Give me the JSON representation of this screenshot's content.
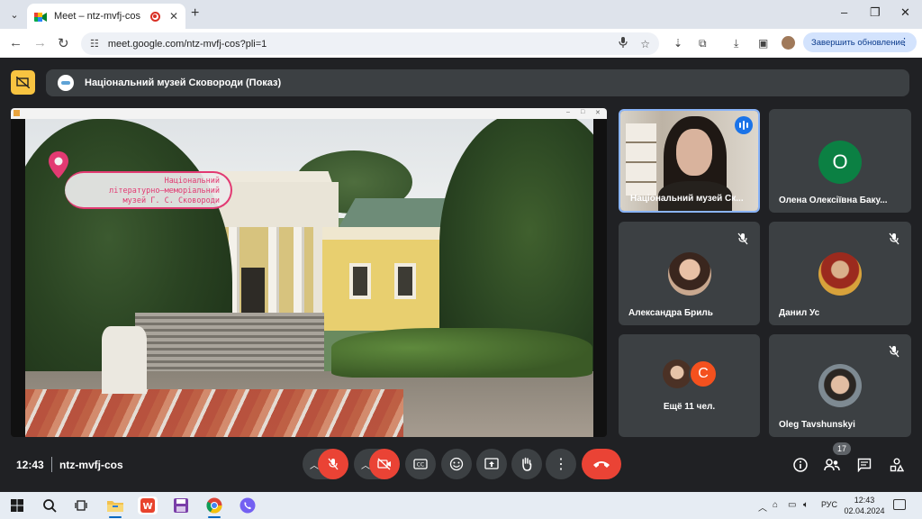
{
  "browser": {
    "tab_title": "Meet – ntz-mvfj-cos",
    "url": "meet.google.com/ntz-mvfj-cos?pli=1",
    "update_button": "Завершить обновление",
    "window_controls": [
      "–",
      "❐",
      "✕"
    ]
  },
  "meet": {
    "presentation_title": "Національний музей Сковороди (Показ)",
    "slide_overlay": [
      "Національний",
      "літературно–меморіальний",
      "музей Г. С. Сковороди"
    ],
    "participants": [
      {
        "name": "Національний музей Ск...",
        "speaking": true,
        "muted": false
      },
      {
        "name": "Олена Олексіївна Баку...",
        "initial": "О",
        "avatar_color": "#0b8043",
        "muted": false
      },
      {
        "name": "Александра Бриль",
        "muted": true
      },
      {
        "name": "Данил Ус",
        "muted": true
      },
      {
        "name": "Ещё 11 чел.",
        "initial": "С",
        "avatar_color": "#f4511e"
      },
      {
        "name": "Oleg Tavshunskyi",
        "muted": true
      }
    ],
    "time": "12:43",
    "meeting_code": "ntz-mvfj-cos",
    "participant_count": "17",
    "end_call_color": "#ea4335"
  },
  "taskbar": {
    "lang": "РУС",
    "time": "12:43",
    "date": "02.04.2024"
  }
}
